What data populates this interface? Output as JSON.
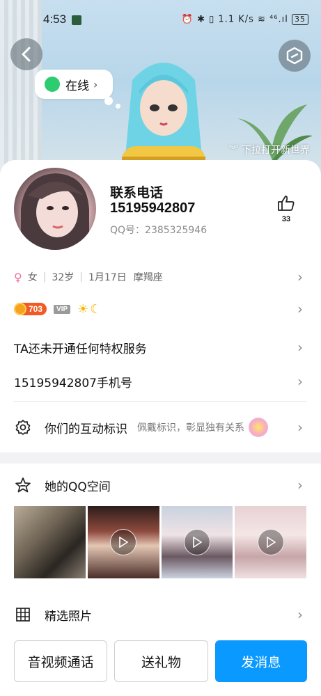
{
  "status_bar": {
    "time": "4:53",
    "right_text": "⏰ ✱ ▯ 1.1 K/s ≋ ⁴⁶.ıl",
    "battery": "35"
  },
  "header": {
    "online_label": "在线",
    "pull_hint": "下拉打开新世界"
  },
  "profile": {
    "name": "联系电话",
    "phone": "15195942807",
    "qq": "QQ号：2385325946",
    "likes": "33",
    "gender_symbol": "♀",
    "gender": "女",
    "age": "32岁",
    "birthday": "1月17日",
    "zodiac": "摩羯座",
    "level_badge": "703",
    "vip_badge": "VIP"
  },
  "rows": {
    "privilege": "TA还未开通任何特权服务",
    "phone_line": "15195942807手机号",
    "interact_title": "你们的互动标识",
    "interact_note": "佩戴标识，彰显独有关系",
    "qzone_title": "她的QQ空间",
    "photos_title": "精选照片"
  },
  "bottom_bar": {
    "call_label": "音视频通话",
    "gift_label": "送礼物",
    "message_label": "发消息"
  },
  "colors": {
    "primary_button": "#0a99ff",
    "online_dot": "#2ecc71",
    "female_symbol": "#f06a9a"
  }
}
